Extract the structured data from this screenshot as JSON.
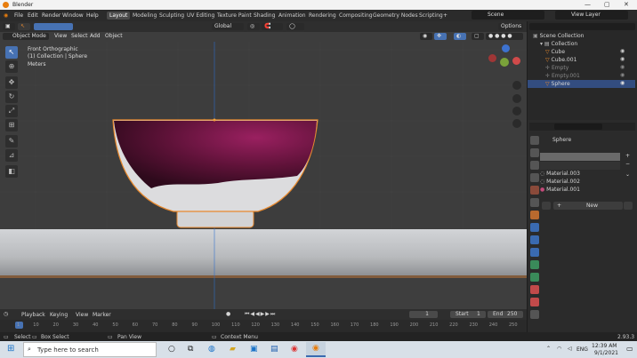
{
  "window": {
    "title": "Blender",
    "controls": [
      "—",
      "▢",
      "✕"
    ]
  },
  "menu": [
    "File",
    "Edit",
    "Render",
    "Window",
    "Help"
  ],
  "workspaces": [
    "Layout",
    "Modeling",
    "Sculpting",
    "UV Editing",
    "Texture Paint",
    "Shading",
    "Animation",
    "Rendering",
    "Compositing",
    "Geometry Nodes",
    "Scripting"
  ],
  "active_workspace": "Layout",
  "scene": {
    "name": "Scene",
    "view_layer": "View Layer"
  },
  "viewport_header": {
    "transform": "Global",
    "options": "Options"
  },
  "viewport_menu": {
    "mode": "Object Mode",
    "items": [
      "View",
      "Select",
      "Add",
      "Object"
    ]
  },
  "overlay": {
    "view": "Front Orthographic",
    "collection": "(1) Collection | Sphere",
    "units": "Meters"
  },
  "outliner": {
    "root": "Scene Collection",
    "collection": "Collection",
    "items": [
      {
        "name": "Cube",
        "selected": false
      },
      {
        "name": "Cube.001",
        "selected": false
      },
      {
        "name": "Empty",
        "selected": false
      },
      {
        "name": "Empty.001",
        "selected": false
      },
      {
        "name": "Sphere",
        "selected": true
      }
    ]
  },
  "properties": {
    "object": "Sphere",
    "materials": [
      "Material.003",
      "Material.002",
      "Material.001"
    ],
    "new_label": "New"
  },
  "timeline": {
    "menus": [
      "Playback",
      "Keying",
      "View",
      "Marker"
    ],
    "current_frame": "1",
    "start_label": "Start",
    "start": "1",
    "end_label": "End",
    "end": "250",
    "ticks": [
      "1",
      "10",
      "20",
      "30",
      "40",
      "50",
      "60",
      "70",
      "80",
      "90",
      "100",
      "110",
      "120",
      "130",
      "140",
      "150",
      "160",
      "170",
      "180",
      "190",
      "200",
      "210",
      "220",
      "230",
      "240",
      "250"
    ]
  },
  "status_bar": {
    "select": "Select",
    "box_select": "Box Select",
    "pan_view": "Pan View",
    "context_menu": "Context Menu",
    "version": "2.93.3"
  },
  "taskbar": {
    "search_placeholder": "Type here to search",
    "lang": "ENG",
    "time": "12:39 AM",
    "date": "9/1/2021"
  },
  "colors": {
    "accent": "#4772b3",
    "selection_outline": "#e8892e",
    "bowl_dark": "#3a0a22",
    "bowl_light": "#8b1a4f"
  }
}
